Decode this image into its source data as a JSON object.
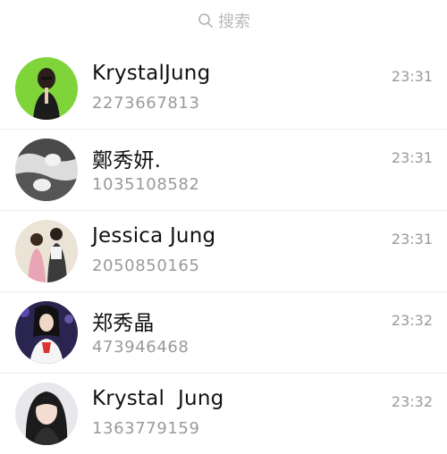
{
  "search": {
    "icon": "search-icon",
    "label": "搜索"
  },
  "contacts": [
    {
      "name": "KrystalJung",
      "number": "2273667813",
      "time": "23:31",
      "avatar_bg": "#7fd43a"
    },
    {
      "name": "鄭秀妍.",
      "number": "1035108582",
      "time": "23:31",
      "avatar_bg": "#d9d9d9"
    },
    {
      "name": "Jessica Jung",
      "number": "2050850165",
      "time": "23:31",
      "avatar_bg": "#e9e2d6"
    },
    {
      "name": "郑秀晶",
      "number": "473946468",
      "time": "23:32",
      "avatar_bg": "#2a2450"
    },
    {
      "name": "Krystal  Jung",
      "number": "1363779159",
      "time": "23:32",
      "avatar_bg": "#e8e8ec"
    }
  ]
}
